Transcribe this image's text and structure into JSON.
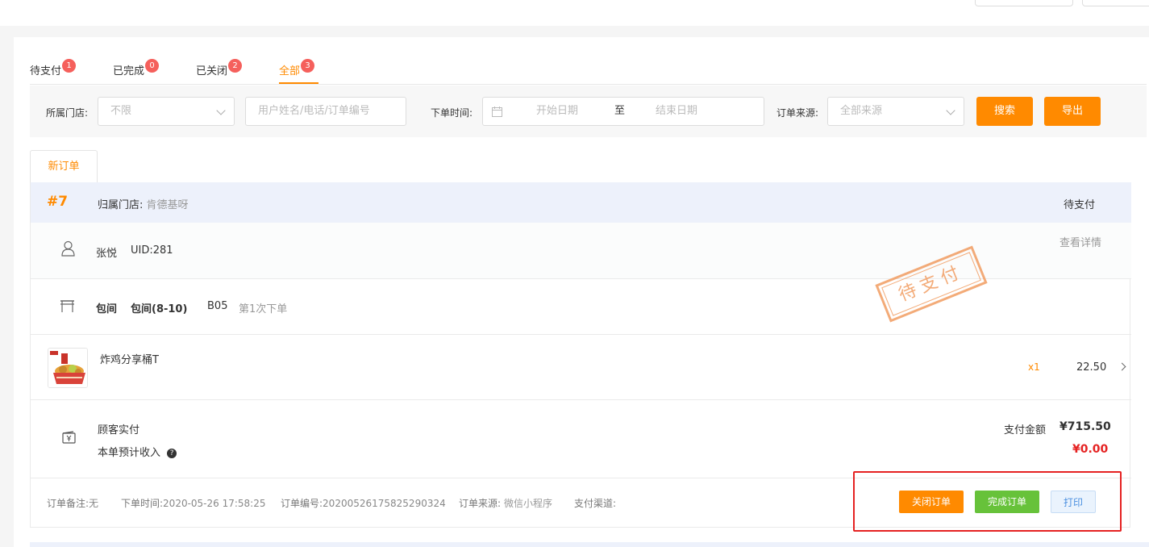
{
  "tabs": [
    {
      "label": "待支付",
      "count": "1"
    },
    {
      "label": "已完成",
      "count": "0"
    },
    {
      "label": "已关闭",
      "count": "2"
    },
    {
      "label": "全部",
      "count": "3"
    }
  ],
  "filter": {
    "store_label": "所属门店:",
    "store_value": "不限",
    "user_placeholder": "用户姓名/电话/订单编号",
    "time_label": "下单时间:",
    "start_placeholder": "开始日期",
    "range_sep": "至",
    "end_placeholder": "结束日期",
    "source_label": "订单来源:",
    "source_value": "全部来源",
    "search_button": "搜索",
    "export_button": "导出"
  },
  "subtab": "新订单",
  "order": {
    "number": "#7",
    "store_label": "归属门店:",
    "store_value": "肯德基呀",
    "status": "待支付",
    "user_name": "张悦",
    "user_uid": "UID:281",
    "detail_link": "查看详情",
    "room_type": "包间",
    "room_name": "包间(8-10)",
    "table_no": "B05",
    "order_seq": "第1次下单",
    "product_name": "炸鸡分享桶T",
    "product_qty": "x1",
    "product_price": "22.50",
    "paid_label": "顾客实付",
    "income_label": "本单预计收入",
    "pay_amount_label": "支付金额",
    "pay_amount_value": "¥715.50",
    "income_value": "¥0.00",
    "stamp_text": "待支付",
    "remark_label": "订单备注:",
    "remark_value": "无",
    "time_label": "下单时间:",
    "time_value": "2020-05-26 17:58:25",
    "no_label": "订单编号:",
    "no_value": "20200526175825290324",
    "source_label": "订单来源:",
    "source_value": "微信小程序",
    "channel_label": "支付渠道:",
    "close_button": "关闭订单",
    "complete_button": "完成订单",
    "print_button": "打印"
  },
  "colors": {
    "accent": "#ff8a00",
    "badge": "#f5605c",
    "success": "#67c23a",
    "danger": "#e52222"
  }
}
